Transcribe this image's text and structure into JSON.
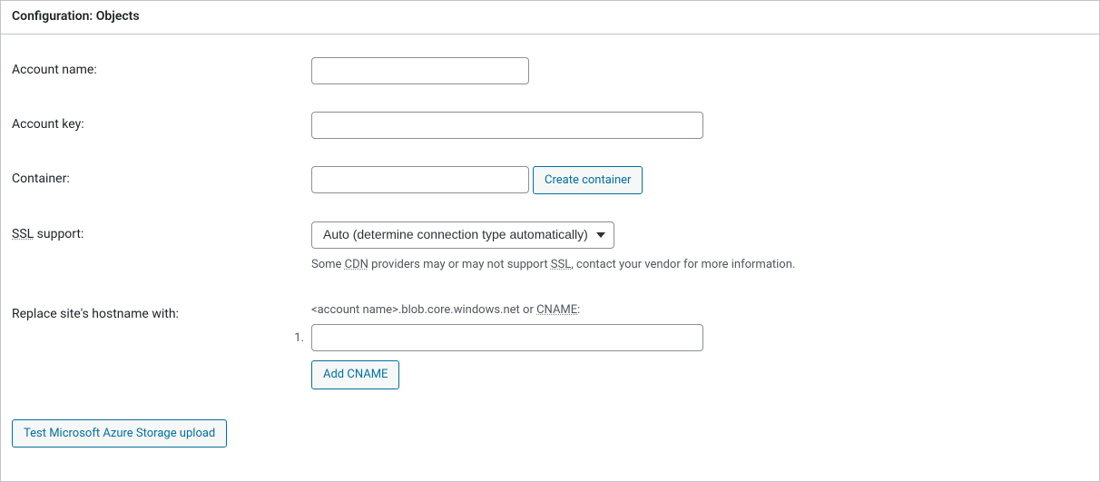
{
  "panel": {
    "title": "Configuration: Objects"
  },
  "rows": {
    "account_name_label": "Account name:",
    "account_name_value": "",
    "account_key_label": "Account key:",
    "account_key_value": "",
    "container_label": "Container:",
    "container_value": "",
    "create_container_button": "Create container",
    "ssl_label_prefix": "",
    "ssl_abbr": "SSL",
    "ssl_label_suffix": " support:",
    "ssl_selected": "Auto (determine connection type automatically)",
    "ssl_desc_pre": "Some ",
    "ssl_desc_abbr1": "CDN",
    "ssl_desc_mid": " providers may or may not support ",
    "ssl_desc_abbr2": "SSL",
    "ssl_desc_post": ", contact your vendor for more information.",
    "replace_hostname_label": "Replace site's hostname with:",
    "hostname_hint_pre": "<account name>.blob.core.windows.net or ",
    "hostname_hint_abbr": "CNAME",
    "hostname_hint_post": ":",
    "cname_index": "1.",
    "cname_value": "",
    "add_cname_button": "Add CNAME",
    "test_button": "Test Microsoft Azure Storage upload"
  }
}
